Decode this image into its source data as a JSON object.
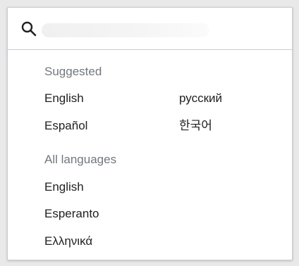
{
  "search": {
    "placeholder": "",
    "value": ""
  },
  "suggested": {
    "heading": "Suggested",
    "items": [
      "English",
      "Español",
      "русский",
      "한국어"
    ]
  },
  "all_languages": {
    "heading": "All languages",
    "items": [
      "English",
      "Esperanto",
      "Ελληνικά"
    ]
  },
  "icons": {
    "search": "search-icon"
  },
  "colors": {
    "heading_text": "#72777d",
    "item_text": "#202122",
    "border": "#c8ccd1"
  }
}
